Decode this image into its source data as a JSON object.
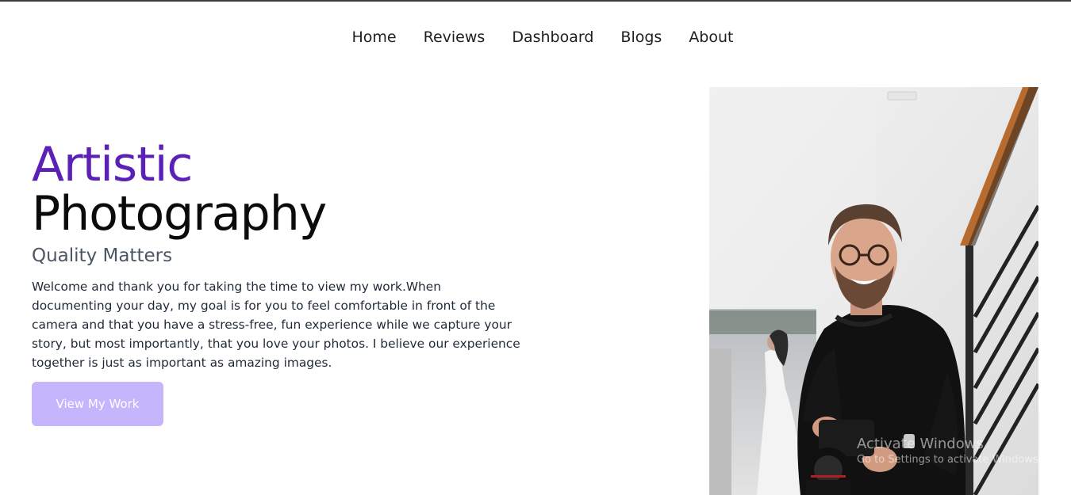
{
  "nav": {
    "items": [
      {
        "label": "Home"
      },
      {
        "label": "Reviews"
      },
      {
        "label": "Dashboard"
      },
      {
        "label": "Blogs"
      },
      {
        "label": "About"
      }
    ]
  },
  "hero": {
    "title_accent": "Artistic",
    "title_main": "Photography",
    "subtitle": "Quality Matters",
    "description": "Welcome and thank you for taking the time to view my work.When documenting your day, my goal is for you to feel comfortable in front of the camera and that you have a stress-free, fun experience while we capture your story, but most importantly, that you love your photos. I believe our experience together is just as important as amazing images.",
    "cta_label": "View My Work"
  },
  "watermark": {
    "line1": "Activate Windows",
    "line2": "Go to Settings to activate Windows."
  },
  "colors": {
    "accent": "#5b21b6",
    "button": "#c4b5fd"
  }
}
